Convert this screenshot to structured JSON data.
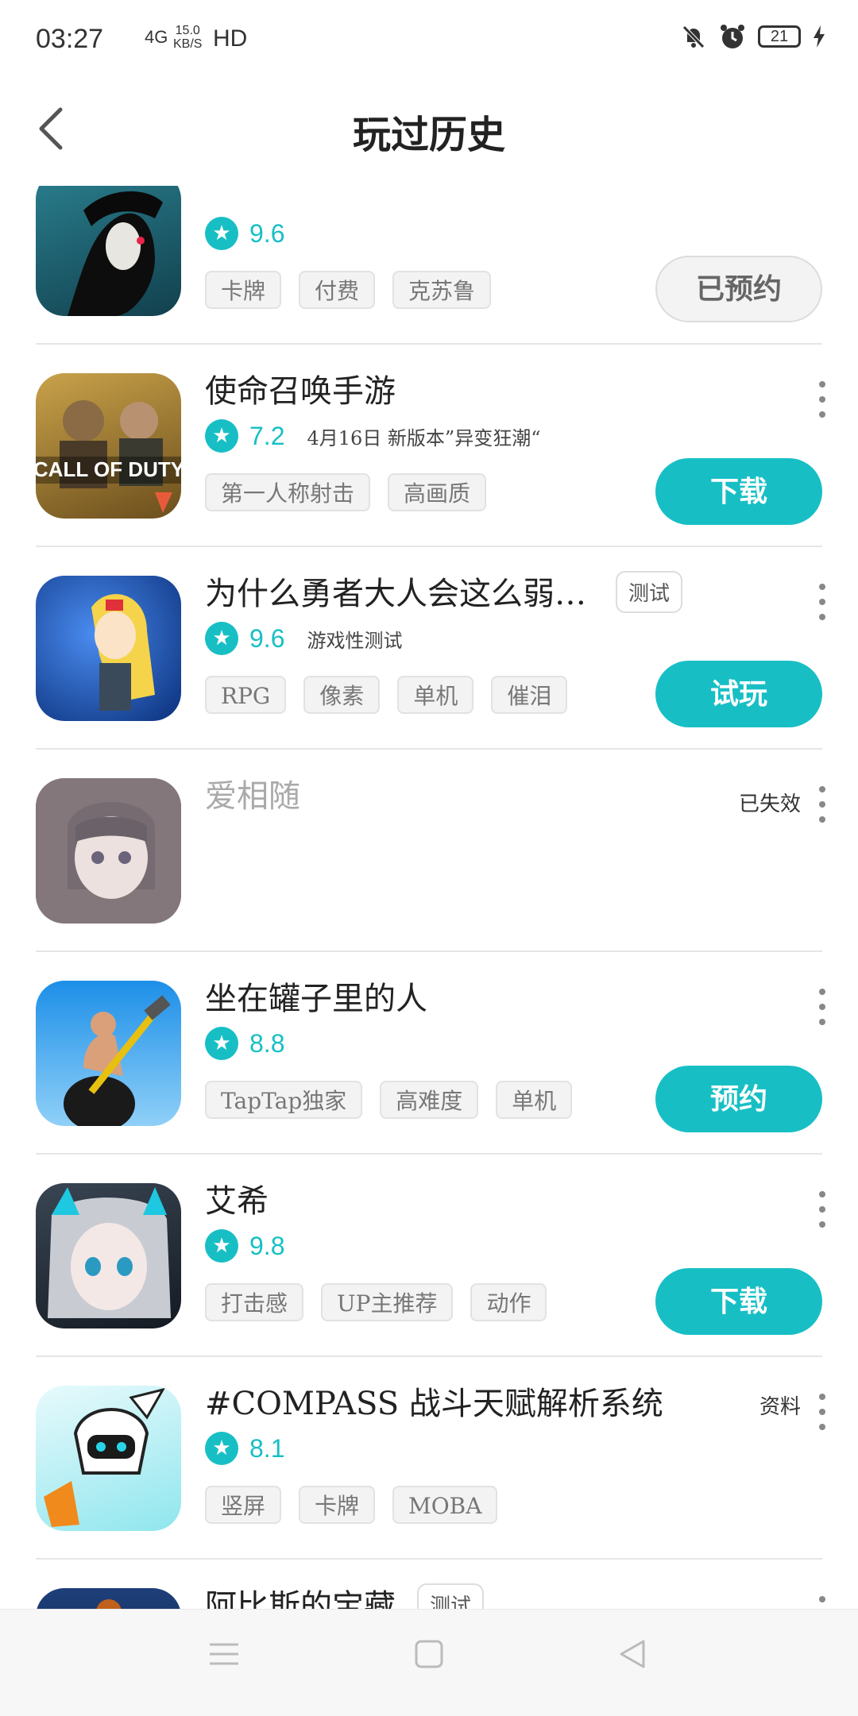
{
  "status_bar": {
    "time": "03:27",
    "network": "4G",
    "speed_value": "15.0",
    "speed_unit": "KB/S",
    "hd": "HD",
    "battery": "21"
  },
  "header": {
    "title": "玩过历史"
  },
  "accent_color": "#17bfc5",
  "items": [
    {
      "name": "",
      "rating": "9.6",
      "subtitle": "",
      "tags": [
        "卡牌",
        "付费",
        "克苏鲁"
      ],
      "button": "已预约",
      "status": ""
    },
    {
      "name": "使命召唤手游",
      "rating": "7.2",
      "subtitle": "4月16日 新版本”异变狂潮“",
      "tags": [
        "第一人称射击",
        "高画质"
      ],
      "button": "下载",
      "status": ""
    },
    {
      "name": "为什么勇者大人会这么弱…",
      "badge": "测试",
      "rating": "9.6",
      "subtitle": "游戏性测试",
      "tags": [
        "RPG",
        "像素",
        "单机",
        "催泪"
      ],
      "button": "试玩",
      "status": ""
    },
    {
      "name": "爱相随",
      "rating": "",
      "subtitle": "",
      "tags": [],
      "button": "",
      "status": "已失效"
    },
    {
      "name": "坐在罐子里的人",
      "rating": "8.8",
      "subtitle": "",
      "tags": [
        "TapTap独家",
        "高难度",
        "单机"
      ],
      "button": "预约",
      "status": ""
    },
    {
      "name": "艾希",
      "rating": "9.8",
      "subtitle": "",
      "tags": [
        "打击感",
        "UP主推荐",
        "动作"
      ],
      "button": "下载",
      "status": ""
    },
    {
      "name": "#COMPASS 战斗天赋解析系统",
      "rating": "8.1",
      "subtitle": "",
      "tags": [
        "竖屏",
        "卡牌",
        "MOBA"
      ],
      "button": "",
      "status": "资料"
    },
    {
      "name": "阿比斯的宝藏",
      "badge": "测试",
      "rating": "",
      "subtitle": "",
      "tags": [],
      "button": "",
      "status": ""
    }
  ]
}
